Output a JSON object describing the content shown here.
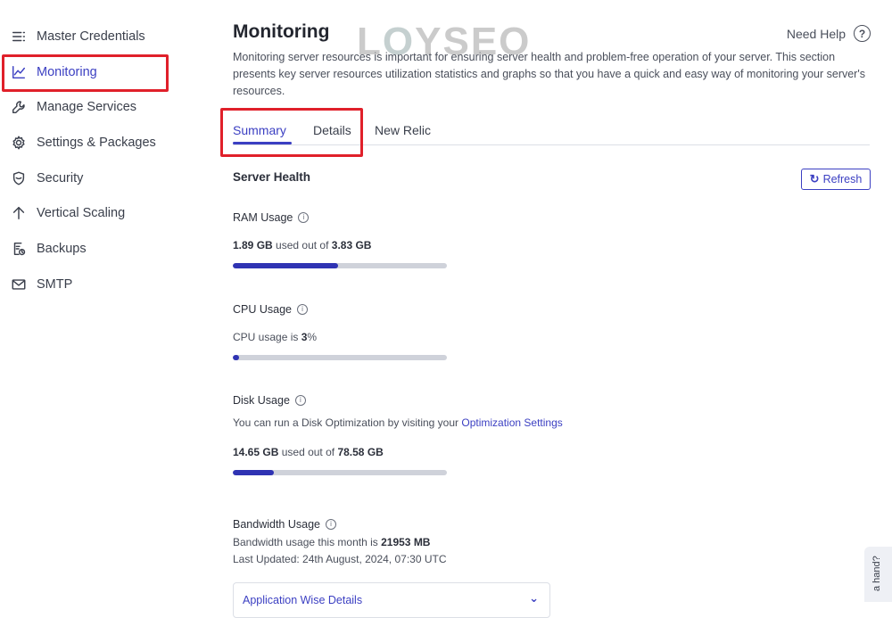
{
  "sidebar": {
    "items": [
      {
        "label": "Master Credentials",
        "icon": "list-icon"
      },
      {
        "label": "Monitoring",
        "icon": "chart-line-icon"
      },
      {
        "label": "Manage Services",
        "icon": "wrench-icon"
      },
      {
        "label": "Settings & Packages",
        "icon": "gear-icon"
      },
      {
        "label": "Security",
        "icon": "shield-icon"
      },
      {
        "label": "Vertical Scaling",
        "icon": "arrow-up-icon"
      },
      {
        "label": "Backups",
        "icon": "backup-icon"
      },
      {
        "label": "SMTP",
        "icon": "mail-icon"
      }
    ]
  },
  "watermark": {
    "text_left": "L",
    "text_o": "O",
    "text_right": "YSEO"
  },
  "header": {
    "title": "Monitoring",
    "help_label": "Need Help",
    "help_icon": "?",
    "description": "Monitoring server resources is important for ensuring server health and problem-free operation of your server. This section presents key server resources utilization statistics and graphs so that you have a quick and easy way of monitoring your server's resources."
  },
  "tabs": [
    {
      "label": "Summary"
    },
    {
      "label": "Details"
    },
    {
      "label": "New Relic"
    }
  ],
  "server_health": {
    "title": "Server Health",
    "refresh_label": "Refresh",
    "refresh_icon": "↻"
  },
  "ram": {
    "label": "RAM Usage",
    "used": "1.89 GB",
    "middle": "used out of",
    "total": "3.83 GB",
    "fraction": 0.49
  },
  "cpu": {
    "label": "CPU Usage",
    "prefix": "CPU usage is",
    "value": "3",
    "suffix": "%",
    "fraction": 0.03
  },
  "disk": {
    "label": "Disk Usage",
    "note_prefix": "You can run a Disk Optimization by visiting your",
    "note_link": "Optimization Settings",
    "used": "14.65 GB",
    "middle": "used out of",
    "total": "78.58 GB",
    "fraction": 0.19
  },
  "bandwidth": {
    "label": "Bandwidth Usage",
    "prefix": "Bandwidth usage this month is",
    "value": "21953 MB",
    "updated": "Last Updated: 24th August, 2024, 07:30 UTC"
  },
  "accordion": {
    "label": "Application Wise Details",
    "chevron": "⌄"
  },
  "hand_tab": {
    "label": "a hand?"
  },
  "info_icon": "i",
  "colors": {
    "accent": "#3b3fc2",
    "highlight": "#e0202a",
    "bar_fill": "#2f33b3",
    "bar_track": "#cfd2da"
  }
}
